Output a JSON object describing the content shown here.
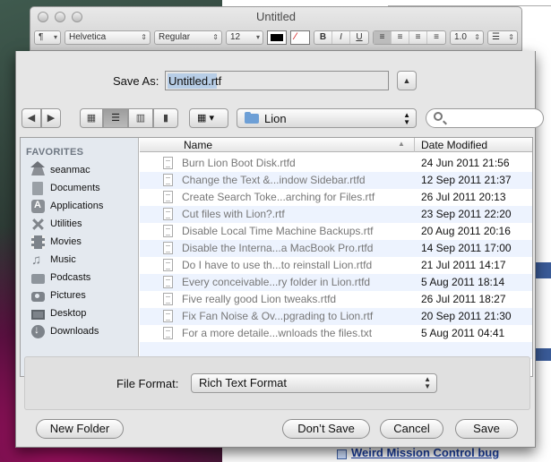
{
  "window": {
    "title": "Untitled"
  },
  "format_bar": {
    "paragraph_style": "¶",
    "font_family": "Helvetica",
    "typeface": "Regular",
    "font_size": "12",
    "bold": "B",
    "italic": "I",
    "underline": "U",
    "line_spacing": "1.0"
  },
  "save_sheet": {
    "save_as_label": "Save As:",
    "filename": "Untitled.rtf",
    "location": "Lion",
    "sidebar": {
      "header": "FAVORITES",
      "items": [
        {
          "label": "seanmac",
          "icon": "home-icon"
        },
        {
          "label": "Documents",
          "icon": "documents-icon"
        },
        {
          "label": "Applications",
          "icon": "applications-icon"
        },
        {
          "label": "Utilities",
          "icon": "utilities-icon"
        },
        {
          "label": "Movies",
          "icon": "movies-icon"
        },
        {
          "label": "Music",
          "icon": "music-icon"
        },
        {
          "label": "Podcasts",
          "icon": "podcasts-icon"
        },
        {
          "label": "Pictures",
          "icon": "pictures-icon"
        },
        {
          "label": "Desktop",
          "icon": "desktop-icon"
        },
        {
          "label": "Downloads",
          "icon": "downloads-icon"
        }
      ]
    },
    "columns": {
      "name": "Name",
      "date": "Date Modified"
    },
    "files": [
      {
        "name": "Burn Lion Boot Disk.rtfd",
        "date": "24 Jun 2011 21:56"
      },
      {
        "name": "Change the Text &...indow Sidebar.rtfd",
        "date": "12 Sep 2011 21:37"
      },
      {
        "name": "Create Search Toke...arching for Files.rtf",
        "date": "26 Jul 2011 20:13"
      },
      {
        "name": "Cut files with Lion?.rtf",
        "date": "23 Sep 2011 22:20"
      },
      {
        "name": "Disable Local Time Machine Backups.rtf",
        "date": "20 Aug 2011 20:16"
      },
      {
        "name": "Disable the Interna...a MacBook Pro.rtfd",
        "date": "14 Sep 2011 17:00"
      },
      {
        "name": "Do I have to use th...to reinstall Lion.rtfd",
        "date": "21 Jul 2011 14:17"
      },
      {
        "name": "Every conceivable...ry folder in Lion.rtfd",
        "date": "5 Aug 2011 18:14"
      },
      {
        "name": "Five really good Lion tweaks.rtfd",
        "date": "26 Jul 2011 18:27"
      },
      {
        "name": "Fix Fan Noise & Ov...pgrading to Lion.rtf",
        "date": "20 Sep 2011 21:30"
      },
      {
        "name": "For a more detaile...wnloads the files.txt",
        "date": "5 Aug 2011 04:41"
      }
    ],
    "file_format_label": "File Format:",
    "file_format": "Rich Text Format",
    "buttons": {
      "new_folder": "New Folder",
      "dont_save": "Don’t Save",
      "cancel": "Cancel",
      "save": "Save"
    }
  },
  "background_browser": {
    "items": [
      "Weird Mission Control bug"
    ]
  }
}
